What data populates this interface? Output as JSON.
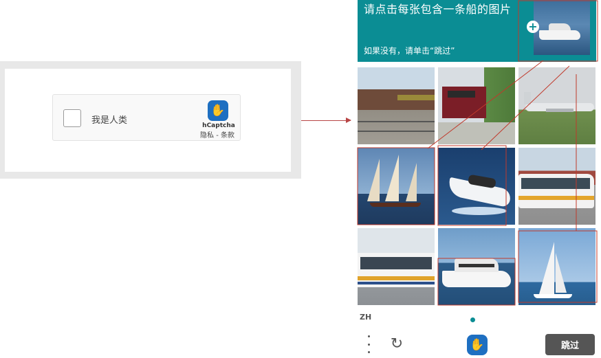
{
  "widget": {
    "human_label": "我是人类",
    "brand": "hCaptcha",
    "links": "隐私 - 条款",
    "logo_icon": "hcaptcha-hand-icon"
  },
  "challenge": {
    "prompt": "请点击每张包含一条船的图片",
    "subprompt": "如果没有，请单击“跳过”",
    "example_icon": "plus-circle-icon",
    "tiles": [
      {
        "subject": "freight-train",
        "selected": false
      },
      {
        "subject": "red-train",
        "selected": false
      },
      {
        "subject": "airplane",
        "selected": false
      },
      {
        "subject": "sailing-ship",
        "selected": true
      },
      {
        "subject": "speedboat",
        "selected": true
      },
      {
        "subject": "bus",
        "selected": false
      },
      {
        "subject": "bus",
        "selected": false
      },
      {
        "subject": "yacht",
        "selected": true
      },
      {
        "subject": "sailboat",
        "selected": true
      }
    ],
    "footer": {
      "language": "ZH",
      "menu_icon": "more-vertical-icon",
      "refresh_icon": "refresh-icon",
      "skip_label": "跳过"
    }
  },
  "colors": {
    "banner": "#0b8d94",
    "annotation": "#c0392b",
    "skip_button": "#555555"
  }
}
